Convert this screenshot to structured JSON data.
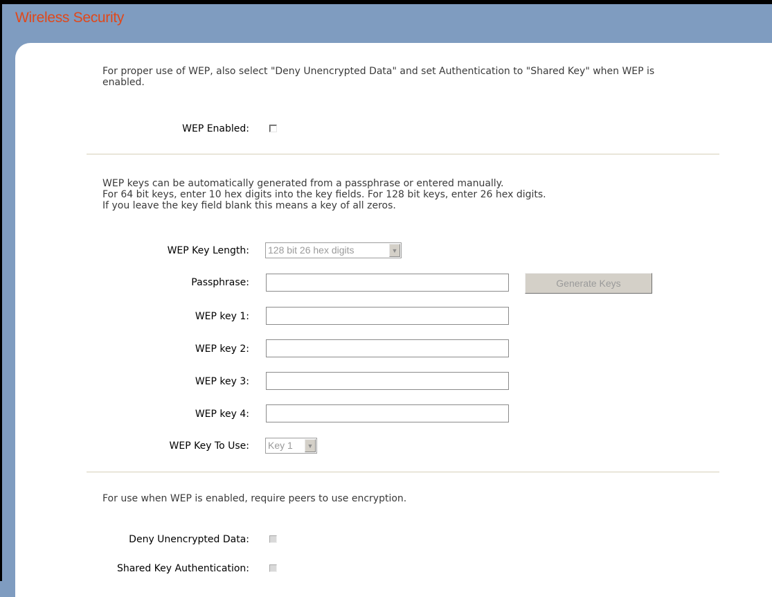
{
  "page": {
    "title": "Wireless Security"
  },
  "wep_section": {
    "intro": "For proper use of WEP, also select \"Deny Unencrypted Data\" and set Authentication to \"Shared Key\" when WEP is enabled.",
    "enabled_label": "WEP Enabled:"
  },
  "keys_section": {
    "help_line1": "WEP keys can be automatically generated from a passphrase or entered manually.",
    "help_line2": "For 64 bit keys, enter 10 hex digits into the key fields. For 128 bit keys, enter 26 hex digits.",
    "help_line3": "If you leave the key field blank this means a key of all zeros.",
    "key_length_label": "WEP Key Length:",
    "key_length_value": "128 bit 26 hex digits",
    "passphrase_label": "Passphrase:",
    "passphrase_value": "",
    "generate_button": "Generate Keys",
    "key1_label": "WEP key 1:",
    "key1_value": "",
    "key2_label": "WEP key 2:",
    "key2_value": "",
    "key3_label": "WEP key 3:",
    "key3_value": "",
    "key4_label": "WEP key 4:",
    "key4_value": "",
    "key_to_use_label": "WEP Key To Use:",
    "key_to_use_value": "Key 1"
  },
  "encryption_section": {
    "help": "For use when WEP is enabled, require peers to use encryption.",
    "deny_label": "Deny Unencrypted Data:",
    "shared_label": "Shared Key Authentication:"
  },
  "icons": {
    "dropdown": "chevron-down-icon"
  }
}
